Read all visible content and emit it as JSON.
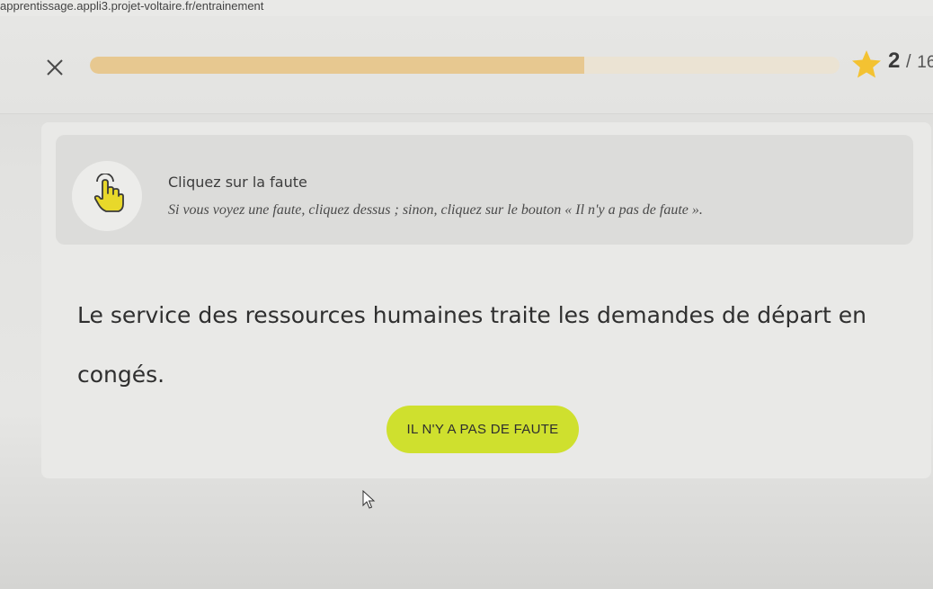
{
  "browser": {
    "url": "apprentissage.appli3.projet-voltaire.fr/entrainement"
  },
  "header": {
    "progress": {
      "current": "2",
      "separator": "/",
      "total": "16",
      "fill_fraction": 0.66
    },
    "icons": {
      "close": "close-icon",
      "star": "star-icon"
    }
  },
  "instruction": {
    "icon": "hand-pointer-icon",
    "title": "Cliquez sur la faute",
    "text": "Si vous voyez une faute, cliquez dessus ; sinon, cliquez sur le bouton « Il n'y a pas de faute »."
  },
  "exercise": {
    "words": [
      "Le",
      "service",
      "des",
      "ressources",
      "humaines",
      "traite",
      "les",
      "demandes",
      "de",
      "départ",
      "en",
      "congés."
    ]
  },
  "actions": {
    "no_fault_label": "IL N'Y A PAS DE FAUTE"
  },
  "colors": {
    "accent_button": "#cfe02e",
    "progress_fill": "#e7c890",
    "star": "#f3c232"
  }
}
